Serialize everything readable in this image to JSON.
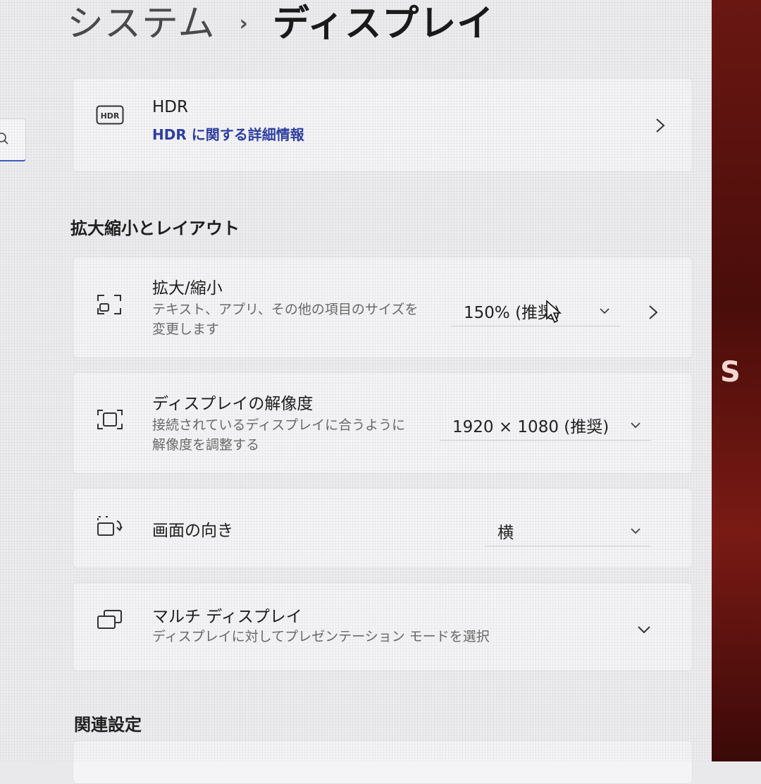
{
  "breadcrumb": {
    "parent": "システム",
    "separator": "›",
    "current": "ディスプレイ"
  },
  "hdr": {
    "icon": "hdr-icon",
    "label": "HDR",
    "link": "HDR に関する詳細情報"
  },
  "scale_section": {
    "title": "拡大縮小とレイアウト"
  },
  "scale": {
    "icon": "scale-icon",
    "label": "拡大/縮小",
    "desc_line1": "テキスト、アプリ、その他の項目のサイズを",
    "desc_line2": "変更します",
    "value": "150% (推奨)"
  },
  "resolution": {
    "icon": "resolution-icon",
    "label": "ディスプレイの解像度",
    "desc_line1": "接続されているディスプレイに合うように",
    "desc_line2": "解像度を調整する",
    "value": "1920 × 1080 (推奨)"
  },
  "orientation": {
    "icon": "rotate-screen-icon",
    "label": "画面の向き",
    "value": "横"
  },
  "multi_display": {
    "icon": "multi-display-icon",
    "label": "マルチ ディスプレイ",
    "desc": "ディスプレイに対してプレゼンテーション モードを選択"
  },
  "related_section": {
    "title": "関連設定"
  },
  "colors": {
    "accent": "#2e3fa3",
    "bezel": "#5a120e"
  }
}
